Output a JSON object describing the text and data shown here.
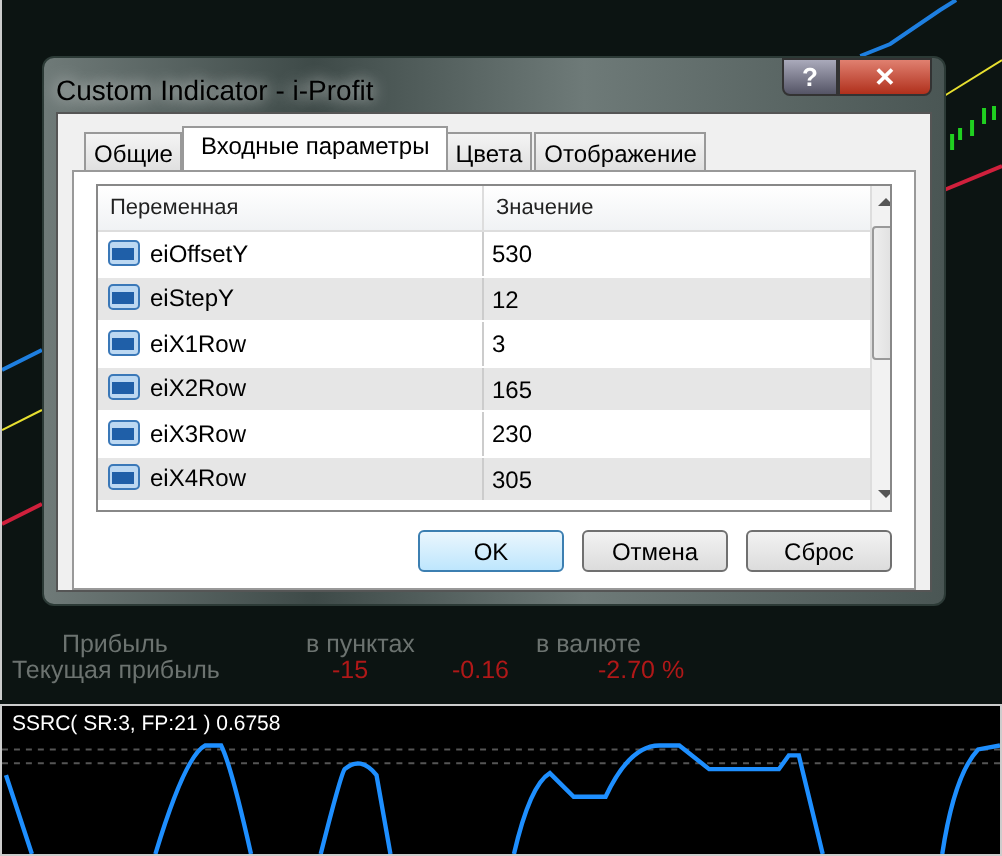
{
  "window": {
    "title": "Custom Indicator - i-Profit",
    "help_button": "?",
    "close_button": "✕"
  },
  "tabs": [
    {
      "label": "Общие",
      "selected": false
    },
    {
      "label": "Входные параметры",
      "selected": true
    },
    {
      "label": "Цвета",
      "selected": false
    },
    {
      "label": "Отображение",
      "selected": false
    }
  ],
  "table": {
    "columns": [
      "Переменная",
      "Значение"
    ],
    "rows": [
      {
        "name": "eiOffsetY",
        "value": "530"
      },
      {
        "name": "eiStepY",
        "value": "12"
      },
      {
        "name": "eiX1Row",
        "value": "3"
      },
      {
        "name": "eiX2Row",
        "value": "165"
      },
      {
        "name": "eiX3Row",
        "value": "230"
      },
      {
        "name": "eiX4Row",
        "value": "305"
      }
    ]
  },
  "buttons": [
    {
      "label": "OK",
      "selected": true
    },
    {
      "label": "Отмена",
      "selected": false
    },
    {
      "label": "Сброс",
      "selected": false
    }
  ],
  "profit_panel": {
    "headers": [
      "Прибыль",
      "в пунктах",
      "в валюте"
    ],
    "row_label": "Текущая прибыль",
    "values": [
      "-15",
      "-0.16",
      "-2.70 %"
    ]
  },
  "indicator": {
    "label": "SSRC( SR:3, FP:21 ) 0.6758"
  }
}
